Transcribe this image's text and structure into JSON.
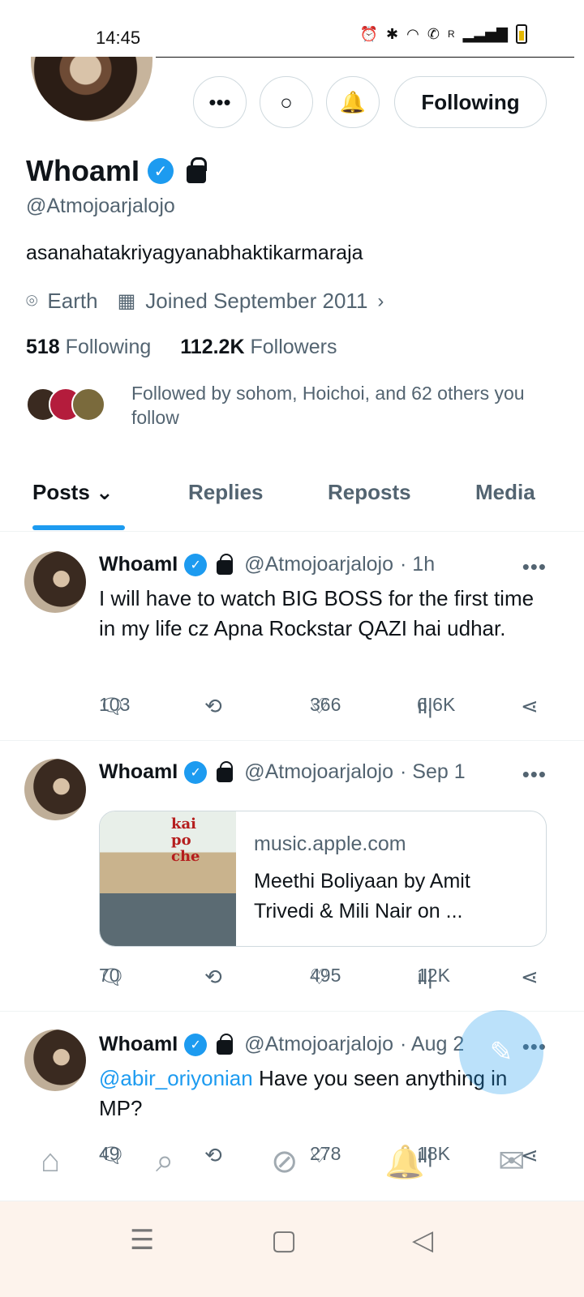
{
  "status_bar": {
    "time": "14:45",
    "signal_label": "R"
  },
  "header": {
    "following_label": "Following"
  },
  "profile": {
    "name": "WhoamI",
    "handle": "@Atmojoarjalojo",
    "bio": "asanahatakriyagyanabhaktikarmaraja",
    "location": "Earth",
    "joined": "Joined September 2011",
    "following_count": "518",
    "following_label": "Following",
    "followers_count": "112.2K",
    "followers_label": "Followers",
    "followed_by": "Followed by sohom, Hoichoi, and 62 others you follow"
  },
  "tabs": [
    {
      "label": "Posts"
    },
    {
      "label": "Replies"
    },
    {
      "label": "Reposts"
    },
    {
      "label": "Media"
    }
  ],
  "posts": [
    {
      "name": "WhoamI",
      "handle": "@Atmojoarjalojo",
      "time": "· 1h",
      "text": "I will have to watch BIG BOSS for the first time in my life cz Apna Rockstar QAZI hai udhar.",
      "replies": "103",
      "likes": "366",
      "views": "6.6K"
    },
    {
      "name": "WhoamI",
      "handle": "@Atmojoarjalojo",
      "time": "· Sep 1",
      "card_domain": "music.apple.com",
      "card_title": "Meethi Boliyaan by Amit Trivedi & Mili Nair on ...",
      "card_image_title": "kai po che",
      "replies": "70",
      "likes": "495",
      "views": "12K"
    },
    {
      "name": "WhoamI",
      "handle": "@Atmojoarjalojo",
      "time": "· Aug 2",
      "mention": "@abir_oriyonian",
      "text": " Have you seen anything in MP?",
      "replies": "49",
      "likes": "278",
      "views": "18K"
    }
  ]
}
